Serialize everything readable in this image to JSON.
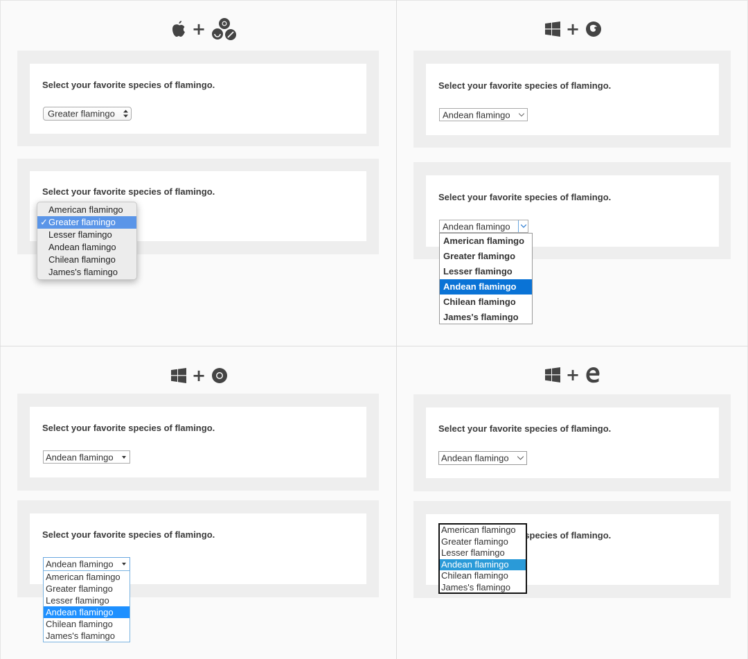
{
  "question": "Select your favorite species of flamingo.",
  "options": [
    "American flamingo",
    "Greater flamingo",
    "Lesser flamingo",
    "Andean flamingo",
    "Chilean flamingo",
    "James's flamingo"
  ],
  "plus": "+",
  "mac": {
    "selected": "Greater flamingo",
    "check": "✓"
  },
  "firefox_win": {
    "selected": "Andean flamingo"
  },
  "chrome_win": {
    "selected": "Andean flamingo"
  },
  "edge_win": {
    "selected": "Andean flamingo"
  }
}
